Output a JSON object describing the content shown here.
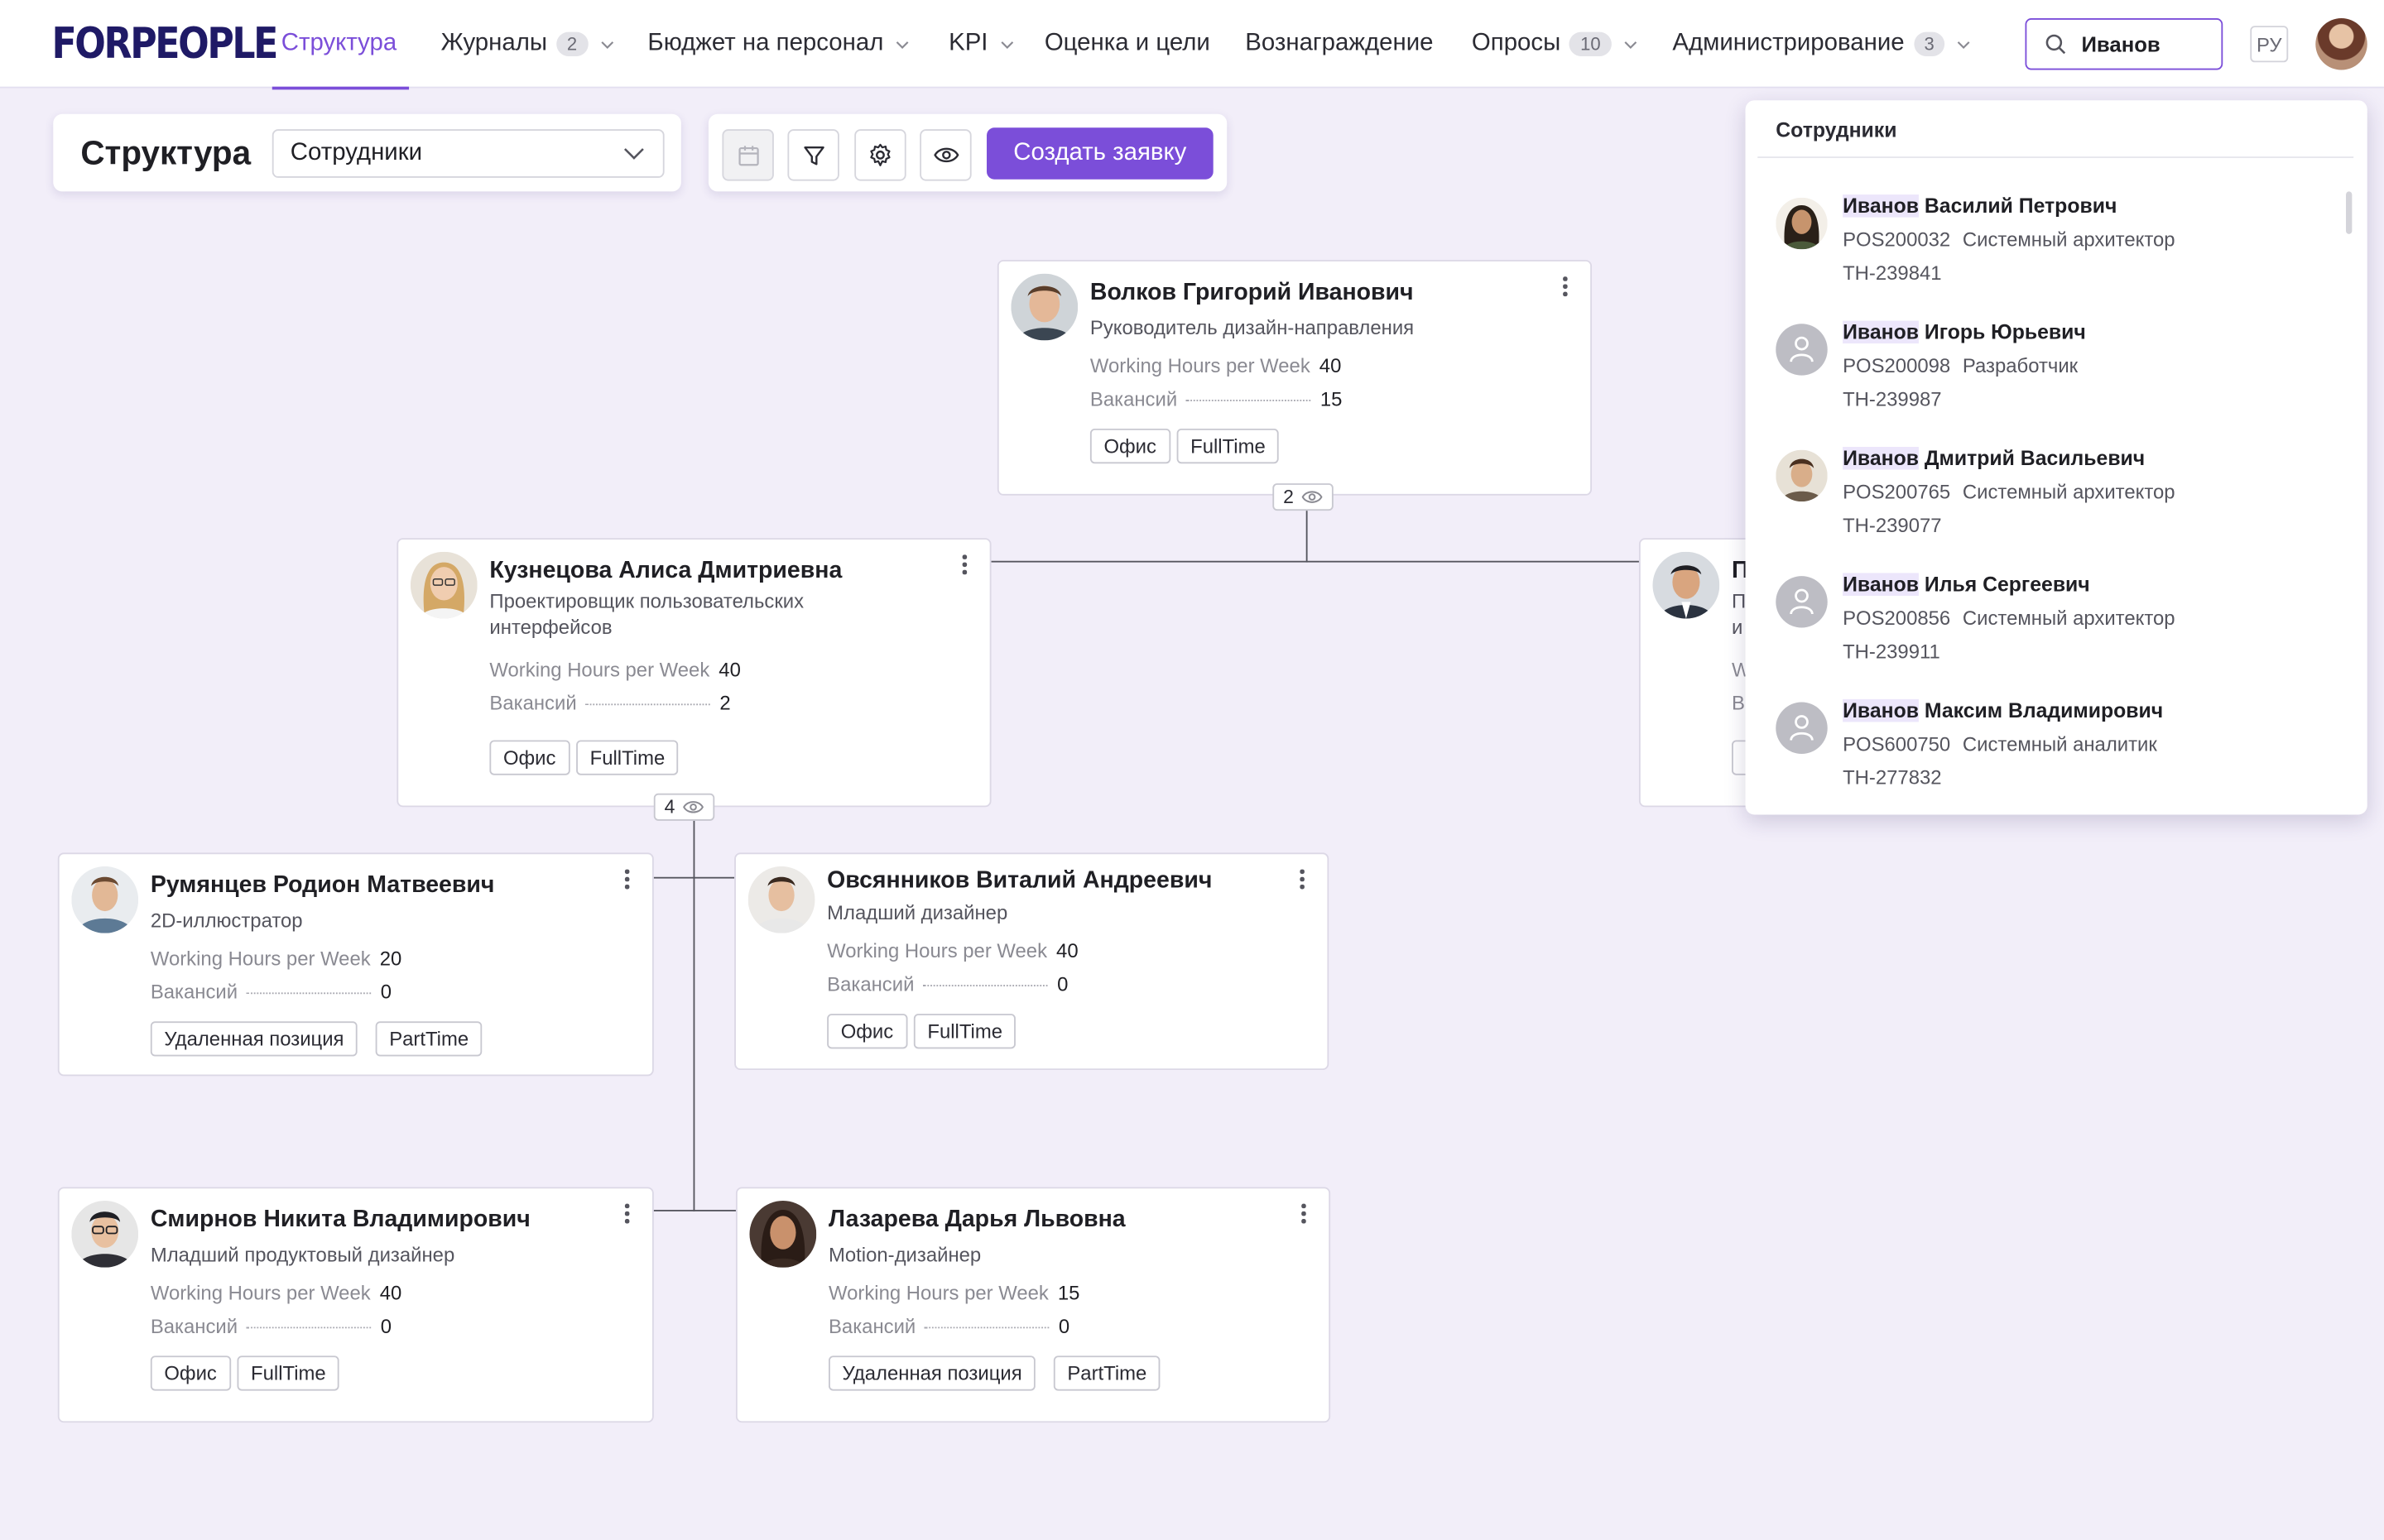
{
  "app": {
    "logo": "FORPEOPLE"
  },
  "nav": [
    {
      "label": "Структура",
      "active": true
    },
    {
      "label": "Журналы",
      "badge": "2",
      "has_chevron": true
    },
    {
      "label": "Бюджет на персонал",
      "has_chevron": true
    },
    {
      "label": "KPI",
      "has_chevron": true
    },
    {
      "label": "Оценка и цели"
    },
    {
      "label": "Вознаграждение"
    },
    {
      "label": "Опросы",
      "badge": "10",
      "has_chevron": true
    },
    {
      "label": "Администрирование",
      "badge": "3",
      "has_chevron": true
    }
  ],
  "search": {
    "value": "Иванов"
  },
  "language": "РУ",
  "toolbar": {
    "title": "Структура",
    "view_select": "Сотрудники",
    "create_button": "Создать заявку"
  },
  "labels": {
    "hours": "Working Hours per Week",
    "vacancies": "Вакансий"
  },
  "cards": {
    "volkov": {
      "name": "Волков Григорий Иванович",
      "role": "Руководитель дизайн-направления",
      "hours": "40",
      "vacancies": "15",
      "tags": [
        "Офис",
        "FullTime"
      ],
      "children_count": "2"
    },
    "kuznetsova": {
      "name": "Кузнецова Алиса Дмитриевна",
      "role": "Проектировщик пользовательских интерфейсов",
      "hours": "40",
      "vacancies": "2",
      "tags": [
        "Офис",
        "FullTime"
      ],
      "children_count": "4"
    },
    "partial": {
      "name_initial": "П",
      "role_initials": [
        "П",
        "и"
      ],
      "stat_initials": [
        "W",
        "В"
      ]
    },
    "rumyantsev": {
      "name": "Румянцев Родион Матвеевич",
      "role": "2D-иллюстратор",
      "hours": "20",
      "vacancies": "0",
      "tags": [
        "Удаленная позиция",
        "PartTime"
      ]
    },
    "ovsyannikov": {
      "name": "Овсянников Виталий Андреевич",
      "role": "Младший дизайнер",
      "hours": "40",
      "vacancies": "0",
      "tags": [
        "Офис",
        "FullTime"
      ]
    },
    "smirnov": {
      "name": "Смирнов Никита Владимирович",
      "role": "Младший продуктовый дизайнер",
      "hours": "40",
      "vacancies": "0",
      "tags": [
        "Офис",
        "FullTime"
      ]
    },
    "lazareva": {
      "name": "Лазарева Дарья Львовна",
      "role": "Motion-дизайнер",
      "hours": "15",
      "vacancies": "0",
      "tags": [
        "Удаленная позиция",
        "PartTime"
      ]
    }
  },
  "dropdown": {
    "title": "Сотрудники",
    "items": [
      {
        "highlight": "Иванов",
        "rest": " Василий Петрович",
        "pos": "POS200032",
        "role": "Системный архитектор",
        "code": "TH-239841",
        "avatar": "photo"
      },
      {
        "highlight": "Иванов",
        "rest": " Игорь Юрьевич",
        "pos": "POS200098",
        "role": "Разработчик",
        "code": "TH-239987",
        "avatar": "generic"
      },
      {
        "highlight": "Иванов",
        "rest": " Дмитрий Васильевич",
        "pos": "POS200765",
        "role": "Системный архитектор",
        "code": "TH-239077",
        "avatar": "photo"
      },
      {
        "highlight": "Иванов",
        "rest": " Илья Сергеевич",
        "pos": "POS200856",
        "role": "Системный архитектор",
        "code": "TH-239911",
        "avatar": "generic"
      },
      {
        "highlight": "Иванов",
        "rest": " Максим Владимирович",
        "pos": "POS600750",
        "role": "Системный аналитик",
        "code": "TH-277832",
        "avatar": "generic"
      }
    ]
  },
  "colors": {
    "accent": "#7b4ed9",
    "background": "#f2eef9",
    "logo": "#1f1a66"
  },
  "icons": [
    "search-icon",
    "chevron-down-icon",
    "calendar-icon",
    "filter-icon",
    "gear-icon",
    "eye-icon",
    "more-vertical-icon",
    "user-icon"
  ]
}
